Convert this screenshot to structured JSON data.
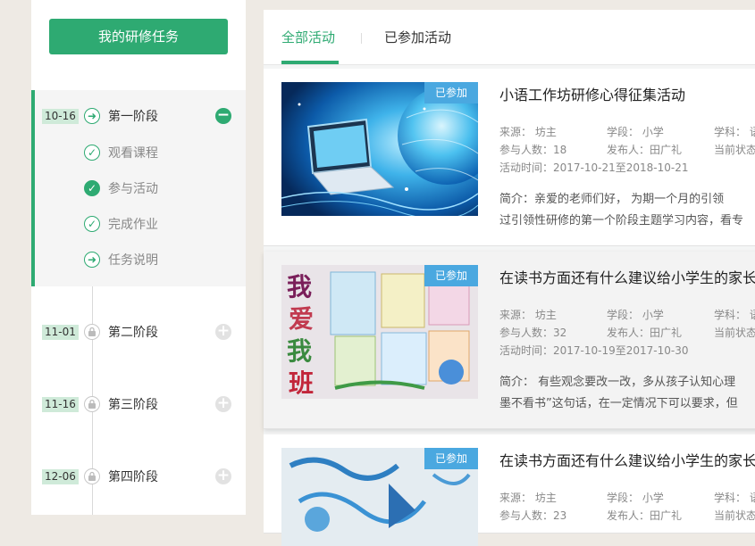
{
  "sidebar": {
    "main_button": "我的研修任务",
    "stages": [
      {
        "date": "10-16",
        "label": "第一阶段",
        "expanded": true,
        "tasks": [
          {
            "label": "观看课程",
            "status": "done"
          },
          {
            "label": "参与活动",
            "status": "current"
          },
          {
            "label": "完成作业",
            "status": "done"
          },
          {
            "label": "任务说明",
            "status": "arrow"
          }
        ]
      },
      {
        "date": "11-01",
        "label": "第二阶段",
        "locked": true
      },
      {
        "date": "11-16",
        "label": "第三阶段",
        "locked": true
      },
      {
        "date": "12-06",
        "label": "第四阶段",
        "locked": true
      }
    ]
  },
  "tabs": [
    {
      "label": "全部活动",
      "active": true
    },
    {
      "label": "已参加活动",
      "active": false
    }
  ],
  "activities": [
    {
      "badge": "已参加",
      "title": "小语工作坊研修心得征集活动",
      "source": "来源： 坊主",
      "stage": "学段： 小学",
      "subject": "学科： 语",
      "participants": "参与人数：18",
      "publisher": "发布人：田广礼",
      "status": "当前状态",
      "time": "活动时间：2017-10-21至2018-10-21",
      "intro1": "简介：亲爱的老师们好，       为期一个月的引领",
      "intro2": "过引领性研修的第一个阶段主题学习内容，看专"
    },
    {
      "badge": "已参加",
      "title": "在读书方面还有什么建议给小学生的家长",
      "source": "来源： 坊主",
      "stage": "学段： 小学",
      "subject": "学科： 语",
      "participants": "参与人数：32",
      "publisher": "发布人：田广礼",
      "status": "当前状态",
      "time": "活动时间：2017-10-19至2017-10-30",
      "intro1": "简介：    有些观念要改一改，多从孩子认知心理",
      "intro2": "墨不看书”这句话，在一定情况下可以要求，但"
    },
    {
      "badge": "已参加",
      "title": "在读书方面还有什么建议给小学生的家长",
      "source": "来源： 坊主",
      "stage": "学段： 小学",
      "subject": "学科： 语",
      "participants": "参与人数：23",
      "publisher": "发布人：田广礼",
      "status": "当前状态"
    }
  ],
  "thumb1_caption": "",
  "thumb2_text": [
    "我",
    "爱",
    "我",
    "班"
  ],
  "colors": {
    "accent": "#2eaa72",
    "badge": "#4aa8e0",
    "date_bg": "#cfead9"
  }
}
